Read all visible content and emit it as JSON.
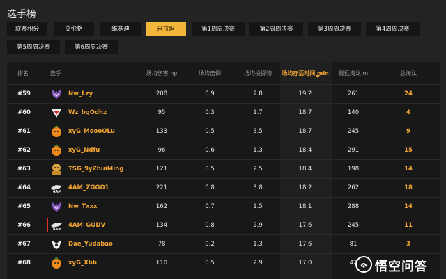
{
  "title": "选手榜",
  "tabs": [
    {
      "label": "联赛积分",
      "active": false
    },
    {
      "label": "艾伦格",
      "active": false
    },
    {
      "label": "维寒迪",
      "active": false
    },
    {
      "label": "米拉玛",
      "active": true
    },
    {
      "label": "第1周周决赛",
      "active": false
    },
    {
      "label": "第2周周决赛",
      "active": false
    },
    {
      "label": "第3周周决赛",
      "active": false
    },
    {
      "label": "第4周周决赛",
      "active": false
    },
    {
      "label": "第5周周决赛",
      "active": false
    },
    {
      "label": "第6周周决赛",
      "active": false
    }
  ],
  "table": {
    "headers": {
      "rank": "排名",
      "player": "选手",
      "damage": "场均伤害 hp",
      "knocks": "场均击倒",
      "throws": "场均投掷物",
      "survival": "场均存活时间 min",
      "longest": "最远淘汰 m",
      "kills": "总淘汰"
    },
    "sorted_column": "survival",
    "rows": [
      {
        "rank": "#59",
        "name": "Nw_Lzy",
        "logo": "nw-wolf-logo",
        "damage": "208",
        "knocks": "0.9",
        "throws": "2.8",
        "survival": "19.2",
        "longest": "261",
        "kills": "24"
      },
      {
        "rank": "#60",
        "name": "Wz_bgOdhz",
        "logo": "wz-logo",
        "damage": "95",
        "knocks": "0.3",
        "throws": "1.7",
        "survival": "18.7",
        "longest": "140",
        "kills": "4"
      },
      {
        "rank": "#61",
        "name": "xyG_MoooOLu",
        "logo": "xyg-orange-logo",
        "damage": "133",
        "knocks": "0.5",
        "throws": "3.5",
        "survival": "18.7",
        "longest": "245",
        "kills": "9"
      },
      {
        "rank": "#62",
        "name": "xyG_Ndfu",
        "logo": "xyg-orange-logo",
        "damage": "96",
        "knocks": "0.6",
        "throws": "1.3",
        "survival": "18.4",
        "longest": "291",
        "kills": "15"
      },
      {
        "rank": "#63",
        "name": "TSG_9yZhuiMing",
        "logo": "tsg-logo",
        "damage": "121",
        "knocks": "0.5",
        "throws": "2.5",
        "survival": "18.4",
        "longest": "198",
        "kills": "14"
      },
      {
        "rank": "#64",
        "name": "4AM_ZGGO1",
        "logo": "4am-logo",
        "damage": "221",
        "knocks": "0.8",
        "throws": "3.8",
        "survival": "18.2",
        "longest": "262",
        "kills": "18"
      },
      {
        "rank": "#65",
        "name": "Nw_Txxx",
        "logo": "nw-wolf-logo",
        "damage": "162",
        "knocks": "0.7",
        "throws": "1.5",
        "survival": "18.1",
        "longest": "288",
        "kills": "14"
      },
      {
        "rank": "#66",
        "name": "4AM_GODV",
        "logo": "4am-logo",
        "damage": "134",
        "knocks": "0.8",
        "throws": "2.9",
        "survival": "17.6",
        "longest": "245",
        "kills": "11",
        "highlighted": true
      },
      {
        "rank": "#67",
        "name": "Dae_Yudabao",
        "logo": "dae-logo",
        "damage": "78",
        "knocks": "0.2",
        "throws": "1.3",
        "survival": "17.6",
        "longest": "81",
        "kills": "3"
      },
      {
        "rank": "#68",
        "name": "xyG_Xbb",
        "logo": "xyg-orange-logo",
        "damage": "110",
        "knocks": "0.5",
        "throws": "2.9",
        "survival": "17.0",
        "longest": "42",
        "kills": ""
      }
    ]
  },
  "watermark": {
    "text": "悟空问答",
    "icon": "wukong-icon"
  },
  "colors": {
    "accent": "#f2a533",
    "active_tab": "#f2b63a",
    "highlight_border": "#e0302a"
  }
}
